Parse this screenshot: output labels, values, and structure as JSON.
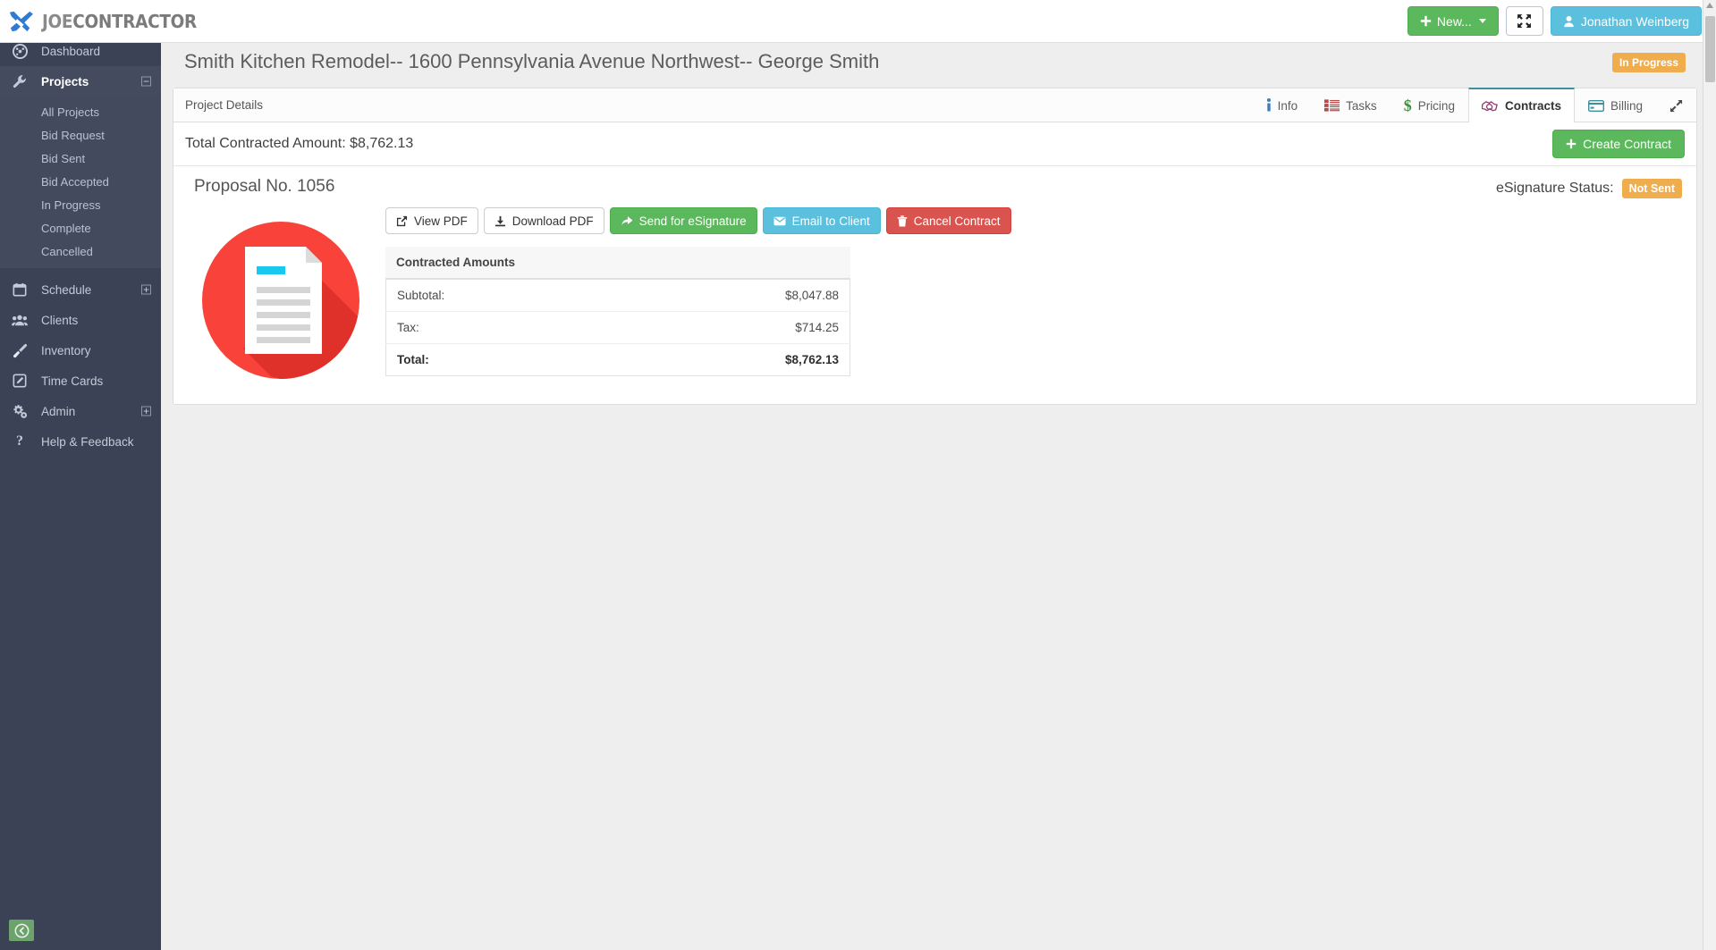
{
  "brand": {
    "name_first": "Joe",
    "name_second": "Contractor",
    "icon": "crossed-tools-icon"
  },
  "topbar": {
    "new_button": "New...",
    "fullscreen_icon": "expand-arrows-icon",
    "user_name": "Jonathan Weinberg",
    "user_icon": "user-icon",
    "plus_icon": "plus-icon"
  },
  "sidebar": {
    "items": [
      {
        "label": "Dashboard",
        "icon": "dashboard-gauge-icon",
        "active": false,
        "expander": ""
      },
      {
        "label": "Projects",
        "icon": "wrench-icon",
        "active": true,
        "expander": "−"
      },
      {
        "label": "Schedule",
        "icon": "calendar-icon",
        "active": false,
        "expander": "+"
      },
      {
        "label": "Clients",
        "icon": "people-icon",
        "active": false,
        "expander": ""
      },
      {
        "label": "Inventory",
        "icon": "paint-brush-icon",
        "active": false,
        "expander": ""
      },
      {
        "label": "Time Cards",
        "icon": "edit-square-icon",
        "active": false,
        "expander": ""
      },
      {
        "label": "Admin",
        "icon": "gears-icon",
        "active": false,
        "expander": "+"
      },
      {
        "label": "Help & Feedback",
        "icon": "question-mark-icon",
        "active": false,
        "expander": ""
      }
    ],
    "projects_sub": [
      {
        "label": "All Projects"
      },
      {
        "label": "Bid Request"
      },
      {
        "label": "Bid Sent"
      },
      {
        "label": "Bid Accepted"
      },
      {
        "label": "In Progress"
      },
      {
        "label": "Complete"
      },
      {
        "label": "Cancelled"
      }
    ],
    "collapse_icon": "arrow-circle-left-icon"
  },
  "page": {
    "title": "Smith Kitchen Remodel-- 1600 Pennsylvania Avenue Northwest-- George Smith",
    "status": "In Progress",
    "status_color": "#f0ad4e"
  },
  "panel": {
    "header_title": "Project Details",
    "tabs": [
      {
        "label": "Info",
        "icon": "info-icon",
        "active": false
      },
      {
        "label": "Tasks",
        "icon": "tasks-list-icon",
        "active": false
      },
      {
        "label": "Pricing",
        "icon": "dollar-icon",
        "active": false
      },
      {
        "label": "Contracts",
        "icon": "handshake-icon",
        "active": true
      },
      {
        "label": "Billing",
        "icon": "credit-card-icon",
        "active": false
      }
    ],
    "expand_icon": "expand-diagonal-icon"
  },
  "contract": {
    "total_contracted_label": "Total Contracted Amount: $8,762.13",
    "create_button": "Create Contract",
    "proposal_title": "Proposal No. 1056",
    "esignature_label": "eSignature Status:",
    "esignature_status": "Not Sent",
    "esignature_color": "#f0ad4e",
    "thumbnail_icon": "document-red-circle-icon",
    "actions": [
      {
        "label": "View PDF",
        "icon": "external-link-icon",
        "style": "default"
      },
      {
        "label": "Download PDF",
        "icon": "download-icon",
        "style": "default"
      },
      {
        "label": "Send for eSignature",
        "icon": "share-arrow-icon",
        "style": "green"
      },
      {
        "label": "Email to Client",
        "icon": "envelope-icon",
        "style": "blue"
      },
      {
        "label": "Cancel Contract",
        "icon": "trash-icon",
        "style": "red"
      }
    ],
    "amounts_caption": "Contracted Amounts",
    "amounts": [
      {
        "label": "Subtotal:",
        "value": "$8,047.88",
        "total": false
      },
      {
        "label": "Tax:",
        "value": "$714.25",
        "total": false
      },
      {
        "label": "Total:",
        "value": "$8,762.13",
        "total": true
      }
    ]
  }
}
